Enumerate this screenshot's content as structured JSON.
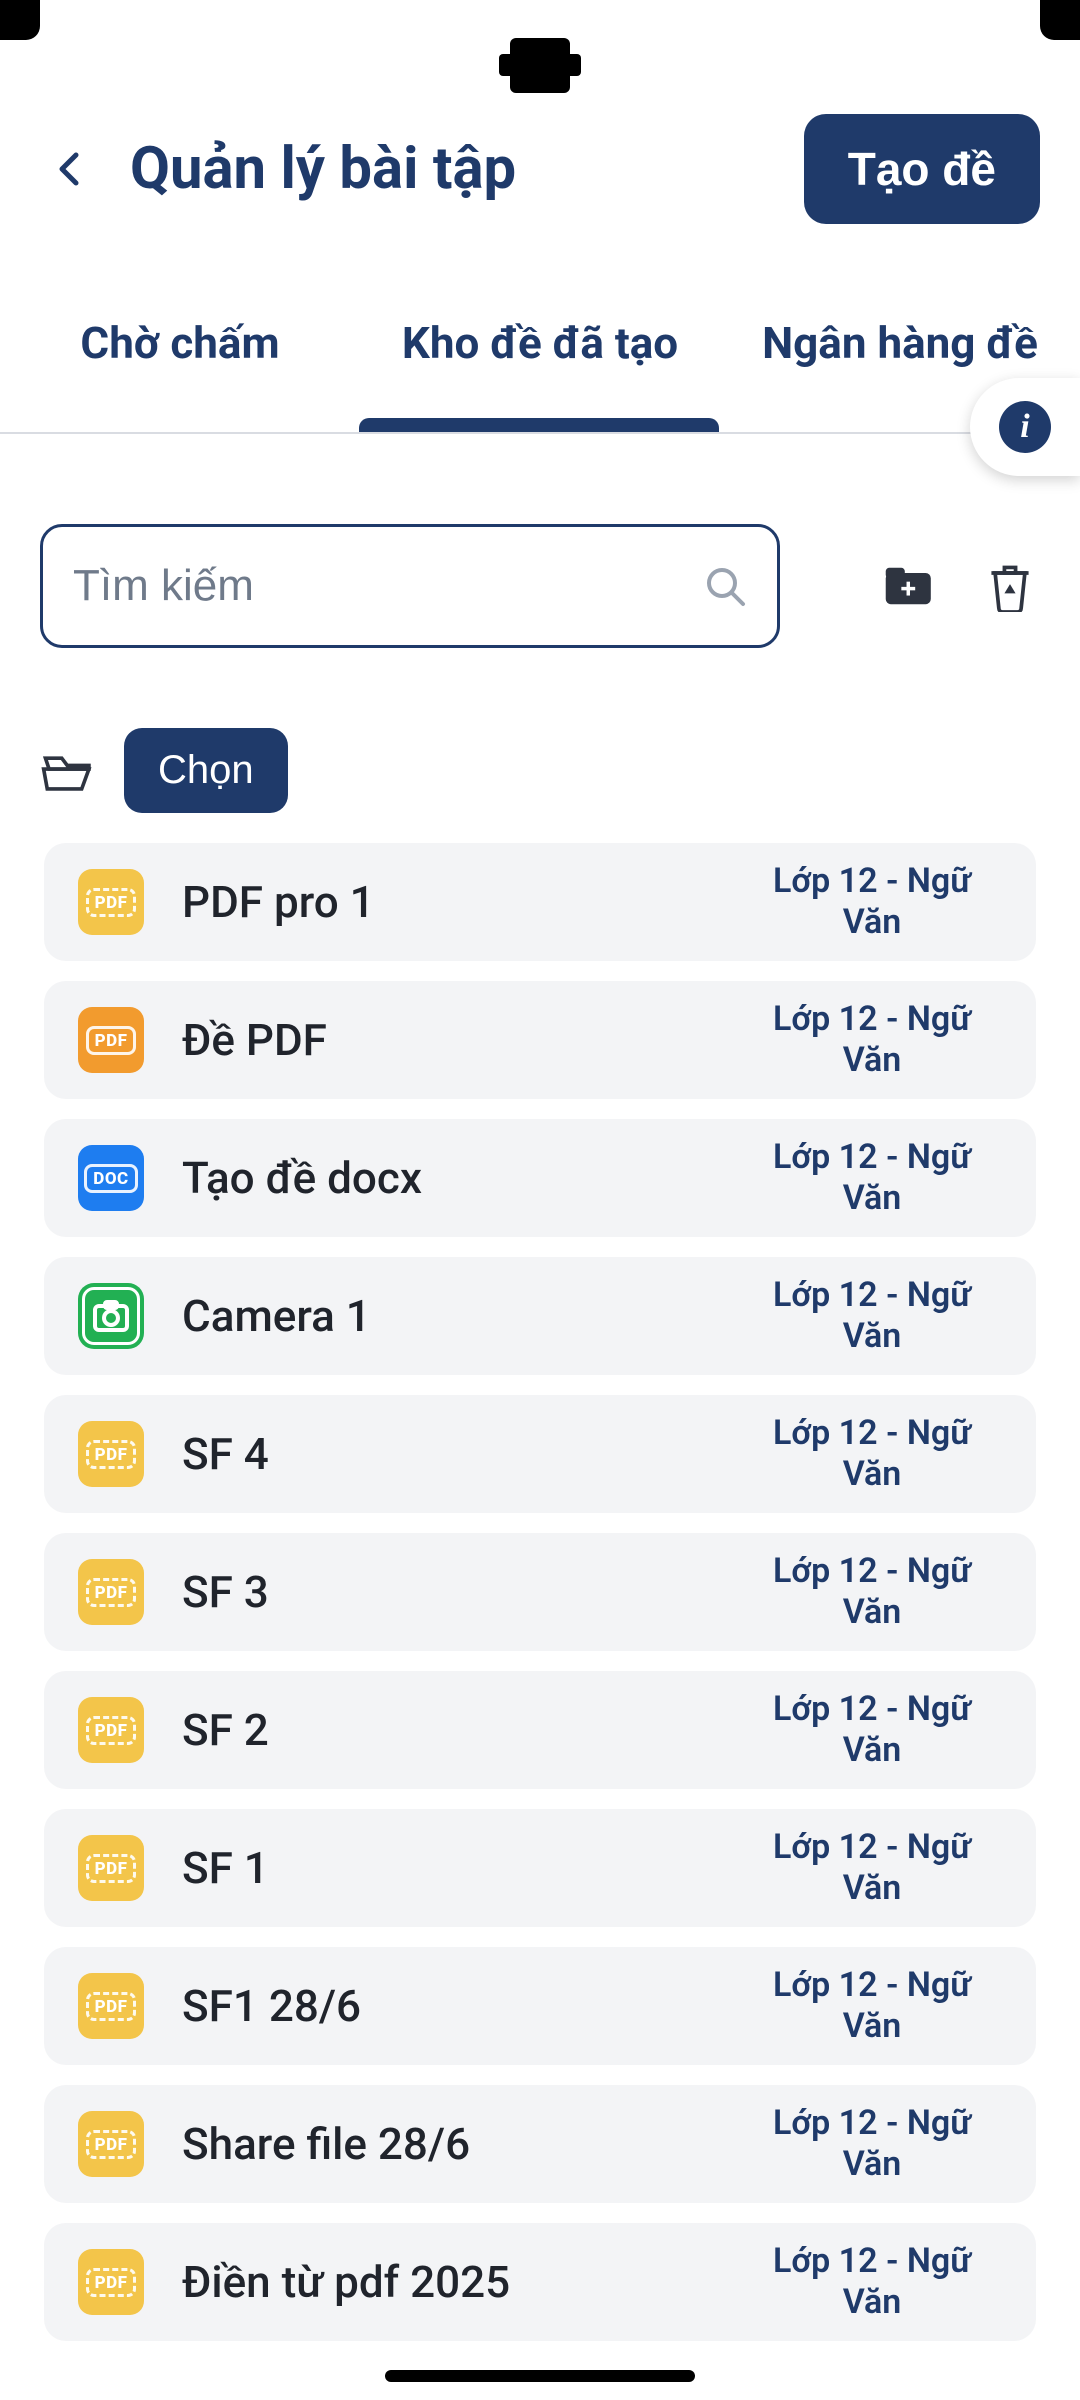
{
  "header": {
    "title": "Quản lý bài tập",
    "cta": "Tạo đề"
  },
  "tabs": [
    {
      "label": "Chờ chấm",
      "active": false
    },
    {
      "label": "Kho đề đã tạo",
      "active": true
    },
    {
      "label": "Ngân hàng đề",
      "active": false
    }
  ],
  "search": {
    "placeholder": "Tìm kiếm",
    "value": ""
  },
  "select": {
    "chip": "Chọn"
  },
  "items": [
    {
      "icon": "pdf-light",
      "badge": "PDF",
      "name": "PDF pro 1",
      "meta": "Lớp 12 - Ngữ Văn"
    },
    {
      "icon": "pdf-dark",
      "badge": "PDF",
      "name": "Đề PDF",
      "meta": "Lớp 12 - Ngữ Văn"
    },
    {
      "icon": "doc",
      "badge": "DOC",
      "name": "Tạo đề docx",
      "meta": "Lớp 12 - Ngữ Văn"
    },
    {
      "icon": "cam",
      "badge": "",
      "name": "Camera 1",
      "meta": "Lớp 12 - Ngữ Văn"
    },
    {
      "icon": "pdf-light",
      "badge": "PDF",
      "name": "SF 4",
      "meta": "Lớp 12 - Ngữ Văn"
    },
    {
      "icon": "pdf-light",
      "badge": "PDF",
      "name": "SF 3",
      "meta": "Lớp 12 - Ngữ Văn"
    },
    {
      "icon": "pdf-light",
      "badge": "PDF",
      "name": "SF 2",
      "meta": "Lớp 12 - Ngữ Văn"
    },
    {
      "icon": "pdf-light",
      "badge": "PDF",
      "name": "SF 1",
      "meta": "Lớp 12 - Ngữ Văn"
    },
    {
      "icon": "pdf-light",
      "badge": "PDF",
      "name": "SF1 28/6",
      "meta": "Lớp 12 - Ngữ Văn"
    },
    {
      "icon": "pdf-light",
      "badge": "PDF",
      "name": "Share file 28/6",
      "meta": "Lớp 12 - Ngữ Văn"
    },
    {
      "icon": "pdf-light",
      "badge": "PDF",
      "name": "Điền từ pdf 2025",
      "meta": "Lớp 12 - Ngữ Văn"
    }
  ]
}
